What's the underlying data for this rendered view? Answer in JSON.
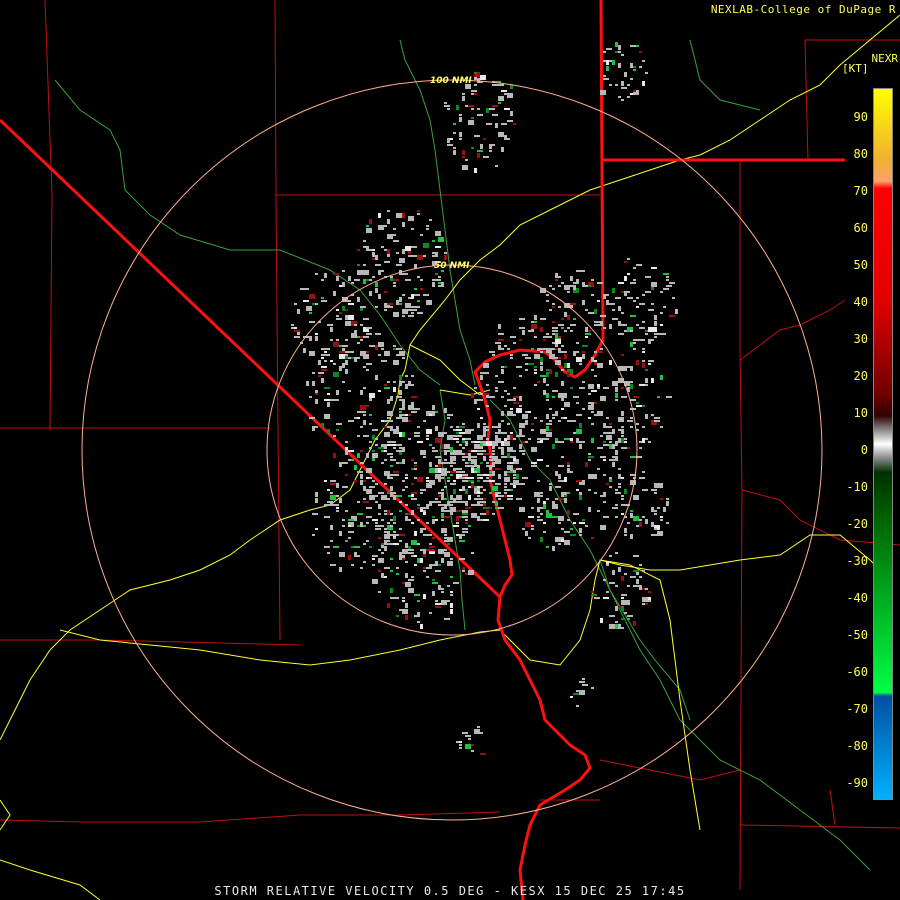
{
  "header": {
    "credit": "NEXLAB-College of DuPage R",
    "product_label": "NEXR",
    "units_label": "[KT]"
  },
  "legend": {
    "ticks": [
      "90",
      "80",
      "70",
      "60",
      "50",
      "40",
      "30",
      "20",
      "10",
      "0",
      "-10",
      "-20",
      "-30",
      "-40",
      "-50",
      "-60",
      "-70",
      "-80",
      "-90"
    ],
    "gradient_stops": [
      {
        "pos": 0,
        "color": "#ffff00"
      },
      {
        "pos": 0.1,
        "color": "#f0b030"
      },
      {
        "pos": 0.13,
        "color": "#ffa070"
      },
      {
        "pos": 0.14,
        "color": "#ff0000"
      },
      {
        "pos": 0.3,
        "color": "#e00000"
      },
      {
        "pos": 0.43,
        "color": "#700000"
      },
      {
        "pos": 0.46,
        "color": "#300000"
      },
      {
        "pos": 0.48,
        "color": "#888888"
      },
      {
        "pos": 0.5,
        "color": "#ffffff"
      },
      {
        "pos": 0.52,
        "color": "#888888"
      },
      {
        "pos": 0.54,
        "color": "#003000"
      },
      {
        "pos": 0.6,
        "color": "#006000"
      },
      {
        "pos": 0.85,
        "color": "#00ff44"
      },
      {
        "pos": 0.855,
        "color": "#0050a0"
      },
      {
        "pos": 1,
        "color": "#00b0ff"
      }
    ]
  },
  "rings": [
    {
      "label": "100 NMI"
    },
    {
      "label": "50 NMI"
    }
  ],
  "colors": {
    "state_border": "#ff1010",
    "county_border": "#c01010",
    "highway": "#ffff30",
    "river": "#3ca03c",
    "range_ring": "#ffb090"
  },
  "footer": {
    "caption": "STORM RELATIVE VELOCITY 0.5 DEG - KESX 15 DEC 25 17:45"
  }
}
